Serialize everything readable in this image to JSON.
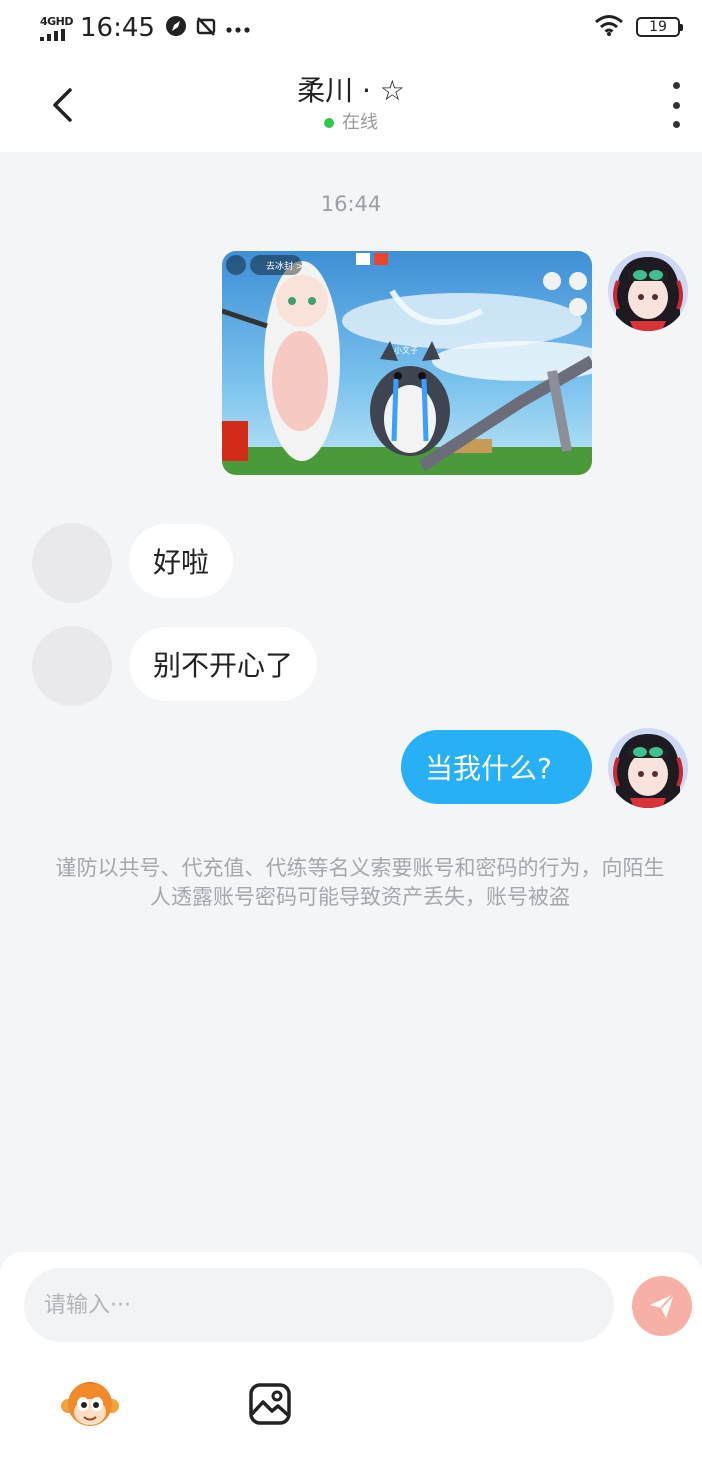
{
  "status_bar": {
    "network": "4GHD",
    "time": "16:45",
    "battery": "19"
  },
  "header": {
    "title": "柔川 · ☆",
    "status": "在线"
  },
  "chat": {
    "timestamp": "16:44",
    "messages": [
      {
        "from": "me",
        "type": "image",
        "image_texts": [
          "去冰封 >",
          "小文子"
        ]
      },
      {
        "from": "other",
        "type": "text",
        "text": "好啦"
      },
      {
        "from": "other",
        "type": "text",
        "text": "别不开心了"
      },
      {
        "from": "me",
        "type": "text",
        "text": "当我什么?"
      }
    ],
    "security_notice": "谨防以共号、代充值、代练等名义索要账号和密码的行为，向陌生人透露账号密码可能导致资产丢失，账号被盗"
  },
  "input": {
    "placeholder": "请输入···"
  },
  "toolbar": {
    "icons": [
      "monkey-emoji-icon",
      "image-picker-icon"
    ]
  },
  "colors": {
    "outgoing_bubble": "#27b0f6",
    "online_dot": "#2fca4c",
    "send_button": "#f6b0a6",
    "background": "#f4f5f7"
  }
}
